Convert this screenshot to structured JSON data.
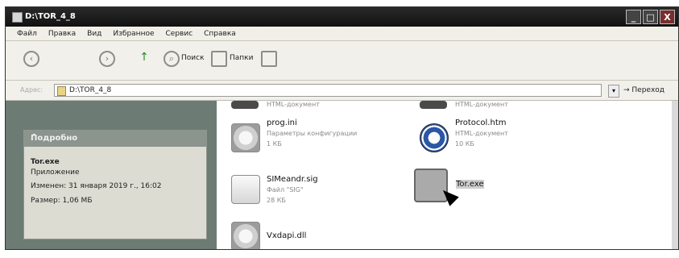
{
  "window": {
    "title": "D:\\TOR_4_8",
    "min": "_",
    "max": "□",
    "close": "X"
  },
  "menu": {
    "items": [
      "Файл",
      "Правка",
      "Вид",
      "Избранное",
      "Сервис",
      "Справка"
    ]
  },
  "toolbar": {
    "search_label": "Поиск",
    "folders_label": "Папки"
  },
  "address": {
    "label": "Адрес:",
    "value": "D:\\TOR_4_8",
    "go_label": "Переход"
  },
  "details": {
    "header": "Подробно",
    "file_name": "Tor.exe",
    "file_type": "Приложение",
    "modified": "Изменен: 31 января 2019 г., 16:02",
    "size": "Размер: 1,06 МБ"
  },
  "files": {
    "top_left_meta": "HTML-документ",
    "prog": {
      "name": "prog.ini",
      "meta1": "Параметры конфигурации",
      "meta2": "1 КБ"
    },
    "sig": {
      "name": "SIMeandr.sig",
      "meta1": "Файл \"SIG\"",
      "meta2": "28 КБ"
    },
    "vxdapi": {
      "name": "Vxdapi.dll"
    },
    "top_right_meta": "HTML-документ",
    "protocol": {
      "name": "Protocol.htm",
      "meta1": "HTML-документ",
      "meta2": "10 КБ"
    },
    "tor": {
      "name": "Tor.exe"
    }
  }
}
